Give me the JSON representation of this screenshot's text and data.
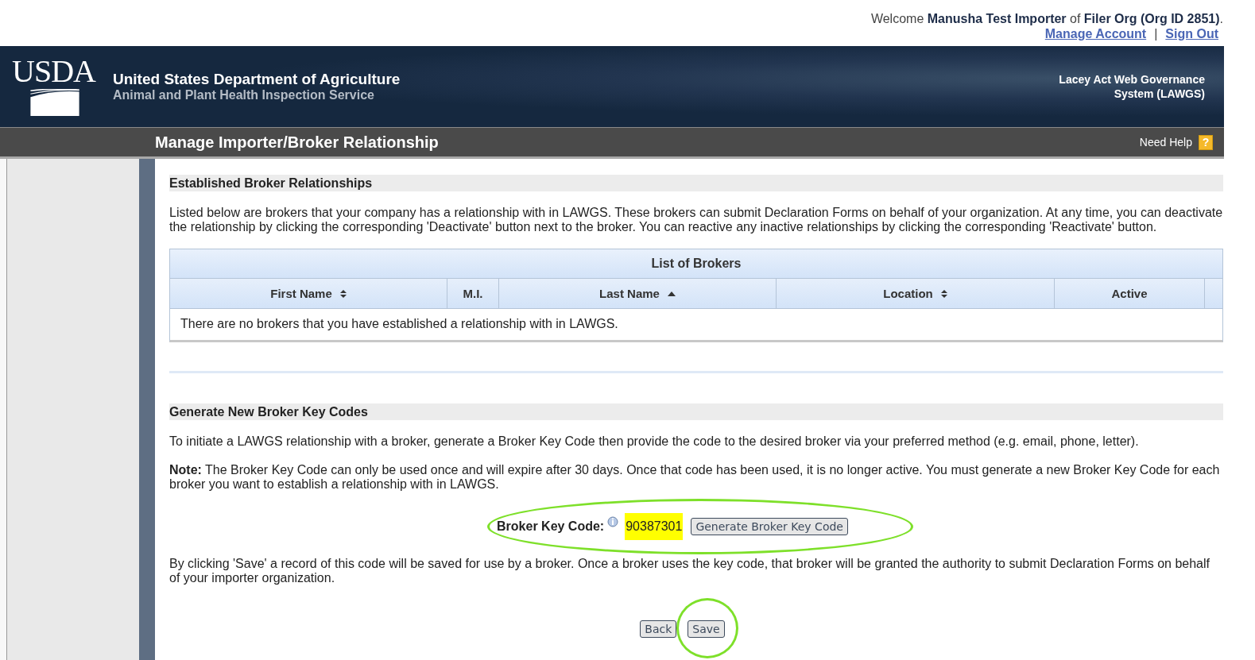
{
  "account": {
    "welcome": "Welcome **Manusha Test Importer** of **Filer Org (Org ID 2851)**.",
    "links": [
      "Manage Account",
      "Sign Out"
    ],
    "separator": "|"
  },
  "banner": {
    "logo": "USDA",
    "agency": "United States Department of Agriculture",
    "service": "Animal and Plant Health Inspection Service",
    "system": "Lacey Act Web Governance System (LAWGS)"
  },
  "title_bar": {
    "title": "Manage Importer/Broker Relationship",
    "help": "Need Help",
    "help_icon": "?"
  },
  "established": {
    "heading": "Established Broker Relationships",
    "intro": "Listed below are brokers that your company has a relationship with in LAWGS. These brokers can submit Declaration Forms on behalf of your organization. At any time, you can deactivate the relationship by clicking the corresponding 'Deactivate' button next to the broker. You can reactive any inactive relationships by clicking the corresponding 'Reactivate' button.",
    "table": {
      "caption": "List of Brokers",
      "columns": [
        {
          "label": "First Name",
          "kind": "sortable"
        },
        {
          "label": "M.I.",
          "kind": "plain"
        },
        {
          "label": "Last Name",
          "kind": "ascending"
        },
        {
          "label": "Location",
          "kind": "sortable"
        },
        {
          "label": "Active",
          "kind": "plain"
        }
      ],
      "empty": "There are no brokers that you have established a relationship with in LAWGS."
    }
  },
  "generate": {
    "heading": "Generate New Broker Key Codes",
    "intro": "To initiate a LAWGS relationship with a broker, generate a Broker Key Code then provide the code to the desired broker via your preferred method (e.g. email, phone, letter).",
    "note": "**Note:** The Broker Key Code can only be used once and will expire after 30 days. Once that code has been used, it is no longer active. You must generate a new Broker Key Code for each broker you want to establish a relationship with in LAWGS.",
    "key_label": "Broker Key Code:",
    "key_value": "90387301",
    "generate_button": "Generate Broker Key Code",
    "save_info": "By clicking 'Save' a record of this code will be saved for use by a broker. Once a broker uses the key code, that broker will be granted the authority to submit Declaration Forms on behalf of your importer organization.",
    "buttons": [
      "Back",
      "Save"
    ]
  }
}
